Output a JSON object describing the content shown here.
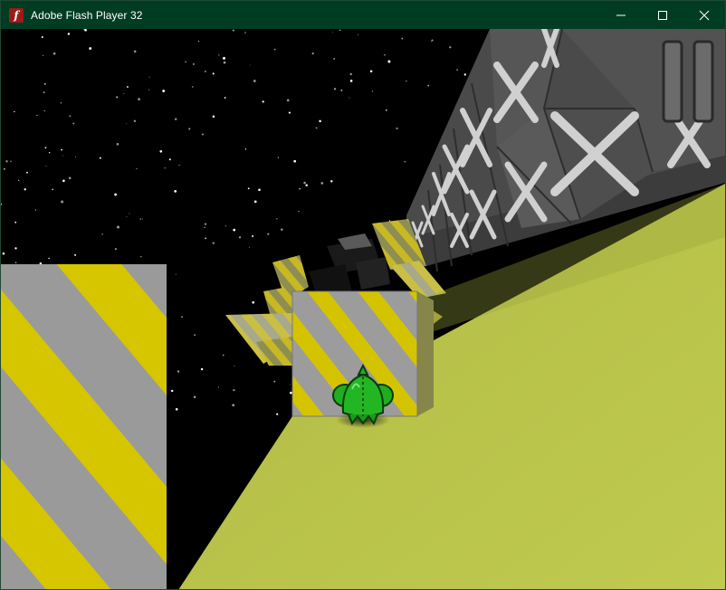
{
  "window": {
    "title": "Adobe Flash Player 32",
    "app_icon": "flash-player-icon",
    "controls": [
      "minimize-icon",
      "maximize-icon",
      "close-icon"
    ]
  },
  "game": {
    "pause_icon": "pause-icon",
    "player_character": "green-alien",
    "colors": {
      "floor": "#b6c24a",
      "stripe_yellow": "#d6c600",
      "stripe_gray": "#9a9a9a",
      "wall": "#4f4f4f",
      "player": "#1fae1f",
      "titlebar": "#003c22"
    }
  }
}
